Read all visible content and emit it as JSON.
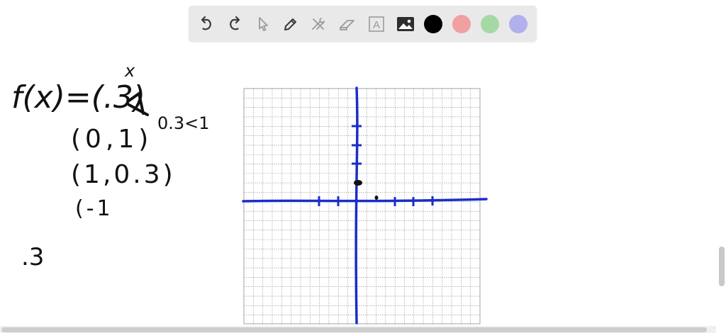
{
  "toolbar": {
    "tools": [
      {
        "name": "undo-icon",
        "label": "Undo"
      },
      {
        "name": "redo-icon",
        "label": "Redo"
      },
      {
        "name": "select-pointer-icon",
        "label": "Select"
      },
      {
        "name": "pen-icon",
        "label": "Pen"
      },
      {
        "name": "tools-icon",
        "label": "Tools"
      },
      {
        "name": "eraser-icon",
        "label": "Eraser"
      },
      {
        "name": "text-box-icon",
        "label": "Text"
      },
      {
        "name": "image-icon",
        "label": "Image"
      }
    ],
    "text_tool_glyph": "A",
    "colors": [
      "#000000",
      "#f0a0a0",
      "#a6d8a6",
      "#b0b0ec"
    ]
  },
  "whiteboard": {
    "ink_color": "#111111",
    "graph_color": "#1a2ec8",
    "grid_color": "#8c8c8c",
    "notes": {
      "function": "f(x)=(.3)",
      "exponent": "x",
      "condition": "0.3<1",
      "point1": "(0,1)",
      "point2": "(1,0.3)",
      "point3": "(-1",
      "side_note": ".3"
    }
  }
}
